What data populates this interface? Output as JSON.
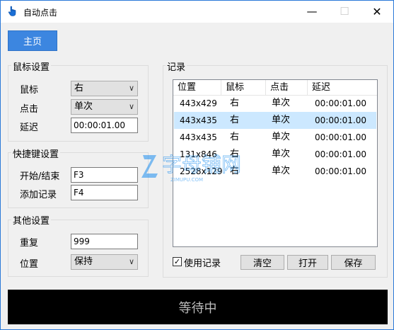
{
  "window": {
    "title": "自动点击",
    "app_icon": "hand-pointer-icon",
    "controls": {
      "minimize": "—",
      "maximize": "☐",
      "close": "✕"
    }
  },
  "home_button": "主页",
  "mouse_settings": {
    "title": "鼠标设置",
    "mouse_label": "鼠标",
    "mouse_value": "右",
    "click_label": "点击",
    "click_value": "单次",
    "delay_label": "延迟",
    "delay_value": "00:00:01.00"
  },
  "hotkey_settings": {
    "title": "快捷键设置",
    "start_stop_label": "开始/结束",
    "start_stop_value": "F3",
    "add_record_label": "添加记录",
    "add_record_value": "F4"
  },
  "other_settings": {
    "title": "其他设置",
    "repeat_label": "重复",
    "repeat_value": "999",
    "position_label": "位置",
    "position_value": "保持"
  },
  "records": {
    "title": "记录",
    "columns": [
      "位置",
      "鼠标",
      "点击",
      "延迟"
    ],
    "rows": [
      [
        "443x429",
        "右",
        "单次",
        "00:00:01.00"
      ],
      [
        "443x435",
        "右",
        "单次",
        "00:00:01.00"
      ],
      [
        "443x435",
        "右",
        "单次",
        "00:00:01.00"
      ],
      [
        "131x846",
        "右",
        "单次",
        "00:00:01.00"
      ],
      [
        "2528x129",
        "右",
        "单次",
        "00:00:01.00"
      ]
    ],
    "selected_row": 1,
    "use_records_label": "使用记录",
    "use_records_checked": true,
    "clear_label": "清空",
    "open_label": "打开",
    "save_label": "保存"
  },
  "watermark": {
    "main": "字母铺网",
    "sub": "ZIMUPU.COM"
  },
  "status": "等待中"
}
